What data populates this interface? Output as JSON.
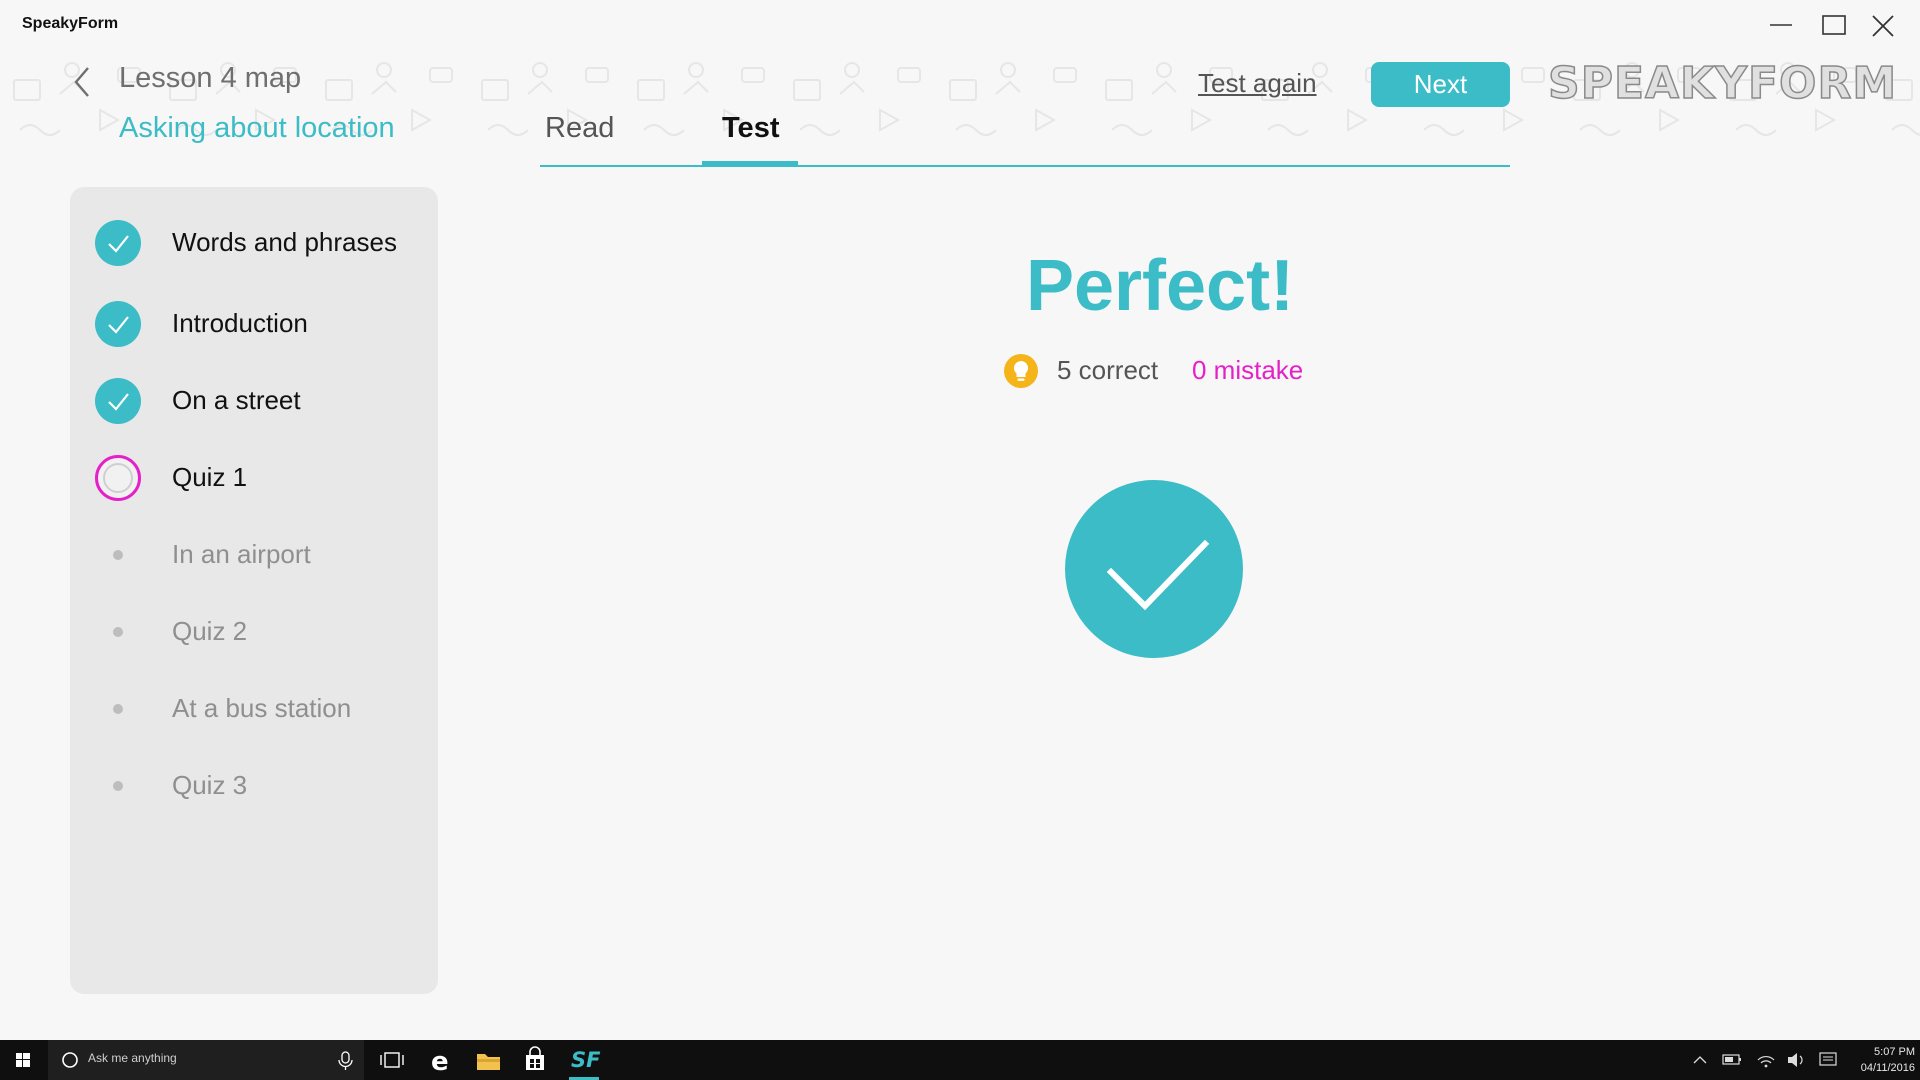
{
  "window": {
    "title": "SpeakyForm"
  },
  "header": {
    "lesson_title": "Lesson 4 map",
    "lesson_subtitle": "Asking about location",
    "tabs": [
      {
        "label": "Read",
        "active": false
      },
      {
        "label": "Test",
        "active": true
      }
    ],
    "test_again_label": "Test again",
    "next_label": "Next",
    "brand_logo": "SPEAKYFORM"
  },
  "sidebar": {
    "items": [
      {
        "label": "Words and phrases",
        "state": "done"
      },
      {
        "label": "Introduction",
        "state": "done"
      },
      {
        "label": "On a street",
        "state": "done"
      },
      {
        "label": "Quiz 1",
        "state": "current"
      },
      {
        "label": "In an airport",
        "state": "locked"
      },
      {
        "label": "Quiz 2",
        "state": "locked"
      },
      {
        "label": "At a bus station",
        "state": "locked"
      },
      {
        "label": "Quiz 3",
        "state": "locked"
      }
    ]
  },
  "result": {
    "title": "Perfect!",
    "correct_text": "5 correct",
    "mistake_text": "0 mistake"
  },
  "taskbar": {
    "search_placeholder": "Ask me anything",
    "time": "5:07 PM",
    "date": "04/11/2016",
    "apps": [
      "task-view",
      "edge",
      "file-explorer",
      "store",
      "speakyform"
    ]
  },
  "colors": {
    "accent": "#3bbcc6",
    "mistake": "#e620c8",
    "bulb": "#f4b41a"
  }
}
